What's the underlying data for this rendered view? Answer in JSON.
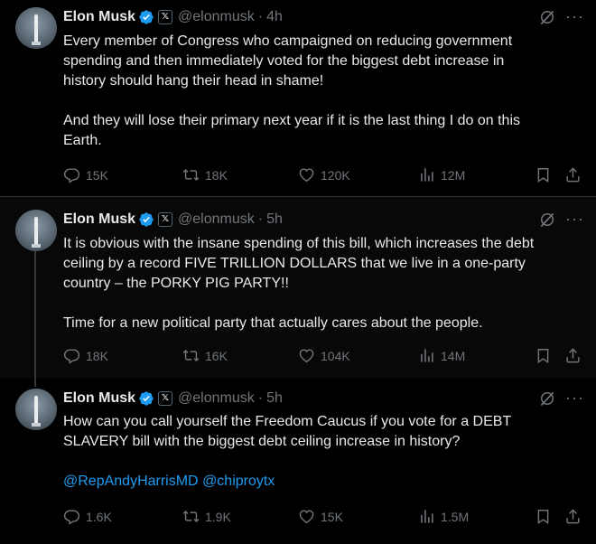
{
  "tweets": [
    {
      "author_name": "Elon Musk",
      "handle": "@elonmusk",
      "time": "4h",
      "lines": [
        "Every member of Congress who campaigned on reducing government",
        "spending and then immediately voted for the biggest debt increase in",
        "history should hang their head in shame!",
        "",
        "And they will lose their primary next year if it is the last thing I do on this",
        "Earth."
      ],
      "replies": "15K",
      "reposts": "18K",
      "likes": "120K",
      "views": "12M"
    },
    {
      "author_name": "Elon Musk",
      "handle": "@elonmusk",
      "time": "5h",
      "lines": [
        "It is obvious with the insane spending of this bill, which increases the debt",
        "ceiling by a record FIVE TRILLION DOLLARS that we live in a one-party",
        "country – the PORKY PIG PARTY!!",
        "",
        "Time for a new political party that actually cares about the people."
      ],
      "replies": "18K",
      "reposts": "16K",
      "likes": "104K",
      "views": "14M"
    },
    {
      "author_name": "Elon Musk",
      "handle": "@elonmusk",
      "time": "5h",
      "lines": [
        "How can you call yourself the Freedom Caucus if you vote for a DEBT",
        "SLAVERY bill with the biggest debt ceiling increase in history?",
        ""
      ],
      "mentions": [
        "@RepAndyHarrisMD",
        "@chiproytx"
      ],
      "replies": "1.6K",
      "reposts": "1.9K",
      "likes": "15K",
      "views": "1.5M"
    }
  ],
  "icons": {
    "verified": "verified-badge-icon",
    "affiliate": "x-affiliate-icon",
    "grok": "grok-icon",
    "more": "more-icon",
    "reply": "reply-icon",
    "repost": "repost-icon",
    "like": "like-icon",
    "views": "views-icon",
    "bookmark": "bookmark-icon",
    "share": "share-icon"
  },
  "badge_letter": "𝕏",
  "more_glyph": "···",
  "colors": {
    "background": "#000000",
    "text": "#e7e9ea",
    "secondary": "#71767b",
    "accent": "#1d9bf0"
  }
}
